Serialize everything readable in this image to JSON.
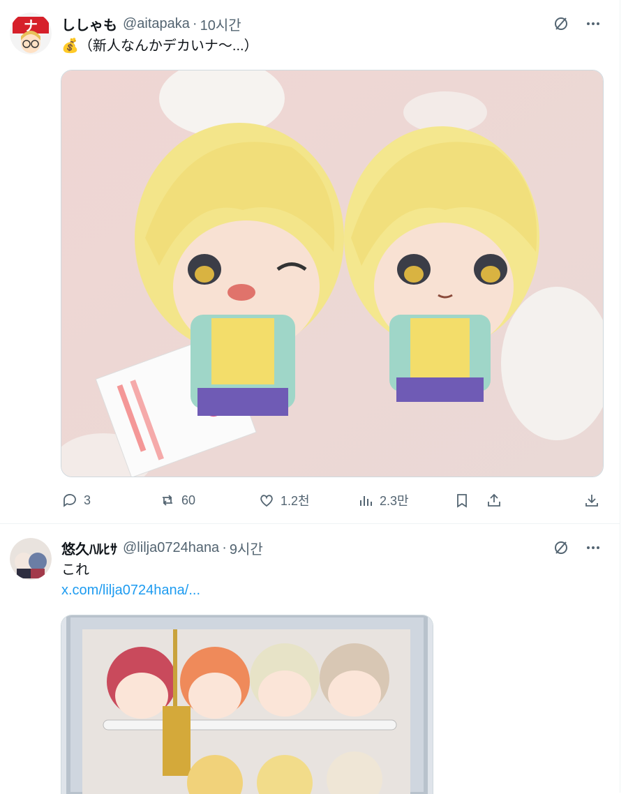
{
  "tweets": [
    {
      "display_name": "ししゃも",
      "handle": "@aitapaka",
      "separator": "·",
      "time": "10시간",
      "text": "💰（新人なんかデカいナ〜...）",
      "actions": {
        "replies": "3",
        "reposts": "60",
        "likes": "1.2천",
        "views": "2.3만"
      }
    },
    {
      "display_name": "悠久ﾊﾙﾋｻ",
      "handle": "@lilja0724hana",
      "separator": "·",
      "time": "9시간",
      "text": "これ",
      "link": "x.com/lilja0724hana/..."
    }
  ],
  "icons": [
    "grok-icon",
    "more-icon",
    "reply-icon",
    "repost-icon",
    "like-icon",
    "views-icon",
    "bookmark-icon",
    "share-icon",
    "download-icon"
  ],
  "colors": {
    "link": "#1d9bf0",
    "muted": "#536471",
    "text": "#0f1419",
    "divider": "#eff3f4"
  }
}
